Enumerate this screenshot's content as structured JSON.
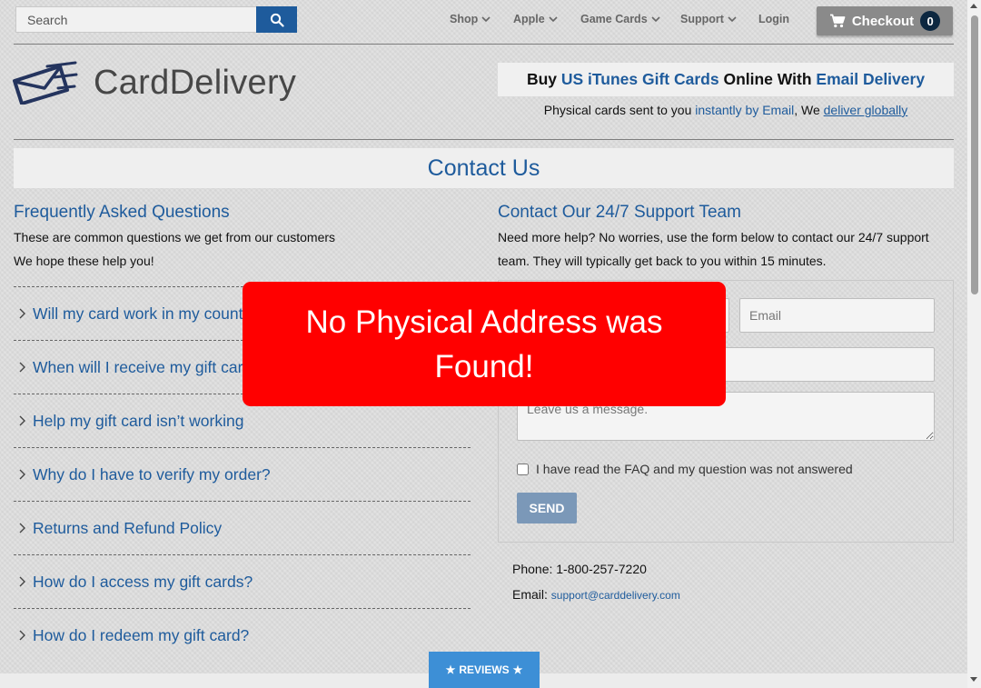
{
  "search": {
    "placeholder": "Search"
  },
  "nav": {
    "shop": "Shop",
    "apple": "Apple",
    "game_cards": "Game Cards",
    "support": "Support",
    "login": "Login"
  },
  "checkout": {
    "label": "Checkout",
    "count": "0"
  },
  "logo": {
    "text": "CardDelivery"
  },
  "tagline": {
    "part1": "Buy ",
    "part2": "US iTunes Gift Cards",
    "part3": " Online With ",
    "part4": "Email Delivery"
  },
  "subtagline": {
    "part1": "Physical cards sent to you ",
    "link1": "instantly by Email",
    "part2": ", We ",
    "link2": "deliver globally "
  },
  "page_title": "Contact Us",
  "faq": {
    "heading": "Frequently Asked Questions",
    "line1": "These are common questions we get from our customers",
    "line2": "We hope these help you!",
    "items": [
      "Will my card work in my country?",
      "When will I receive my gift card?",
      "Help my gift card isn’t working",
      "Why do I have to verify my order?",
      "Returns and Refund Policy",
      "How do I access my gift cards?",
      "How do I redeem my gift card?"
    ]
  },
  "support": {
    "heading": "Contact Our 24/7 Support Team",
    "text": "Need more help? No worries, use the form below to contact our 24/7 support team. They will typically get back to you within 15 minutes."
  },
  "form": {
    "email_placeholder": "Email",
    "message_placeholder": "Leave us a message.",
    "checkbox_label": "I have read the FAQ and my question was not answered",
    "send_label": "SEND"
  },
  "contact": {
    "phone_label": "Phone:",
    "phone_value": "1-800-257-7220",
    "email_label": "Email:",
    "email_value": "support@carddelivery.com"
  },
  "overlay": {
    "message": "No Physical Address was Found!"
  },
  "reviews": {
    "label": "REVIEWS"
  },
  "colors": {
    "brand_blue": "#1e5b9c",
    "alert_red": "#ff0000",
    "checkout_gray": "#8a8a8a"
  }
}
